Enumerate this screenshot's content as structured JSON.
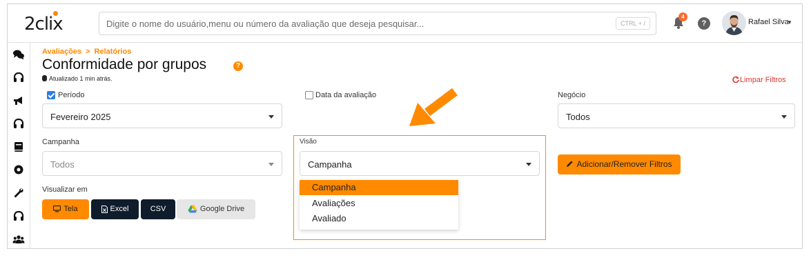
{
  "header": {
    "logo_text": "2clix",
    "search_placeholder": "Digite o nome do usuário,menu ou número da avaliação que deseja pesquisar...",
    "search_shortcut": "CTRL + /",
    "notification_count": "4",
    "help_label": "?",
    "user_name": "Rafael Silva"
  },
  "breadcrumb": {
    "items": [
      "Avaliações",
      "Relatórios"
    ],
    "separator": ">"
  },
  "page": {
    "title": "Conformidade por grupos",
    "help_label": "?",
    "updated_text": "Atualizado 1 min atrás.",
    "clear_filters_label": "Limpar Filtros"
  },
  "filters": {
    "periodo": {
      "label": "Período",
      "checked": true,
      "value": "Fevereiro 2025"
    },
    "data_avaliacao": {
      "label": "Data da avaliação",
      "checked": false
    },
    "negocio": {
      "label": "Negócio",
      "value": "Todos"
    },
    "campanha": {
      "label": "Campanha",
      "value": "Todos"
    },
    "visao": {
      "label": "Visão",
      "value": "Campanha",
      "options": [
        "Campanha",
        "Avaliações",
        "Avaliado"
      ],
      "selected_index": 0
    },
    "add_remove_label": "Adicionar/Remover Filtros"
  },
  "export": {
    "label": "Visualizar em",
    "buttons": [
      "Tela",
      "Excel",
      "CSV",
      "Google Drive"
    ]
  },
  "colors": {
    "accent": "#ff8a00",
    "dark_button": "#0f1c2b",
    "danger": "#e0332b",
    "checkbox": "#2f7de1"
  },
  "sidebar_icons": [
    "chat-icon",
    "headset-icon",
    "megaphone-icon",
    "headset-icon",
    "book-icon",
    "settings-icon",
    "wrench-icon",
    "headset-icon",
    "users-icon"
  ]
}
